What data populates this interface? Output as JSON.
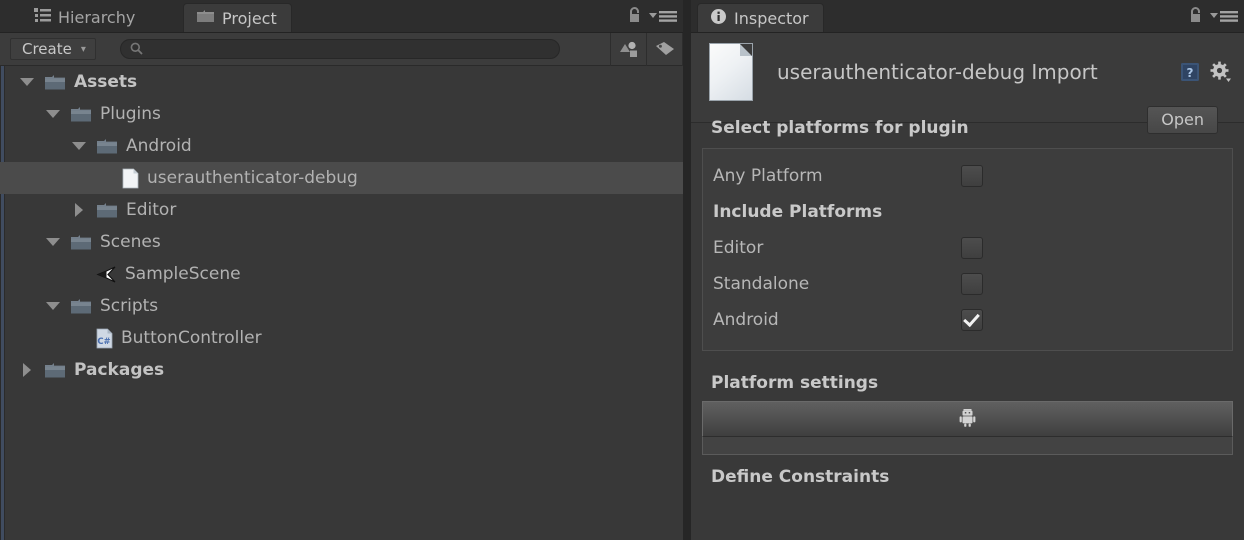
{
  "project_panel": {
    "tabs": [
      {
        "label": "Hierarchy",
        "icon": "hierarchy-list-icon",
        "active": false
      },
      {
        "label": "Project",
        "icon": "folder-icon",
        "active": true
      }
    ],
    "tabbar_controls": [
      {
        "name": "lock-icon"
      },
      {
        "name": "panel-menu-icon"
      }
    ],
    "toolbar": {
      "create_label": "Create",
      "create_caret": "▾",
      "search_value": "",
      "search_placeholder": "",
      "search_icon": "search-icon",
      "filter_type_icon": "filter-by-type-icon",
      "filter_label_icon": "filter-by-label-icon"
    },
    "tree": [
      {
        "label": "Assets",
        "depth": 0,
        "toggle": "down",
        "icon": "folder-icon",
        "bold": true,
        "selected": false
      },
      {
        "label": "Plugins",
        "depth": 1,
        "toggle": "down",
        "icon": "folder-icon",
        "bold": false,
        "selected": false
      },
      {
        "label": "Android",
        "depth": 2,
        "toggle": "down",
        "icon": "folder-icon",
        "bold": false,
        "selected": false
      },
      {
        "label": "userauthenticator-debug",
        "depth": 3,
        "toggle": "none",
        "icon": "file-icon",
        "bold": false,
        "selected": true
      },
      {
        "label": "Editor",
        "depth": 2,
        "toggle": "right",
        "icon": "folder-icon",
        "bold": false,
        "selected": false
      },
      {
        "label": "Scenes",
        "depth": 1,
        "toggle": "down",
        "icon": "folder-icon",
        "bold": false,
        "selected": false
      },
      {
        "label": "SampleScene",
        "depth": 2,
        "toggle": "none",
        "icon": "unity-scene-icon",
        "bold": false,
        "selected": false
      },
      {
        "label": "Scripts",
        "depth": 1,
        "toggle": "down",
        "icon": "folder-icon",
        "bold": false,
        "selected": false
      },
      {
        "label": "ButtonController",
        "depth": 2,
        "toggle": "none",
        "icon": "csharp-script-icon",
        "bold": false,
        "selected": false
      },
      {
        "label": "Packages",
        "depth": 0,
        "toggle": "right",
        "icon": "folder-icon",
        "bold": true,
        "selected": false
      }
    ]
  },
  "inspector": {
    "tab": {
      "label": "Inspector",
      "icon": "info-icon"
    },
    "tabbar_controls": [
      {
        "name": "lock-icon"
      },
      {
        "name": "panel-menu-icon"
      }
    ],
    "asset_title": "userauthenticator-debug Import",
    "asset_icon": "file-icon",
    "help_icon": "help-book-icon",
    "gear_icon": "gear-icon",
    "open_label": "Open",
    "select_platforms_title": "Select platforms for plugin",
    "platform_rows": [
      {
        "label": "Any Platform",
        "type": "checkbox",
        "checked": false
      },
      {
        "label": "Include Platforms",
        "type": "group",
        "checked": false
      },
      {
        "label": "Editor",
        "type": "checkbox",
        "checked": false
      },
      {
        "label": "Standalone",
        "type": "checkbox",
        "checked": false
      },
      {
        "label": "Android",
        "type": "checkbox",
        "checked": true
      }
    ],
    "platform_settings_title": "Platform settings",
    "platform_settings_tab_icon": "android-robot-icon",
    "define_constraints_title": "Define Constraints"
  },
  "colors": {
    "window_bg": "#383838",
    "tabbar_bg": "#2d2d2d",
    "active_tab_bg": "#3b3b3b",
    "toolbar_bg": "#3c3c3c",
    "row_selected_bg": "#4b4b4b",
    "text": "#b9b9b9",
    "heading_text": "#c9c9c9",
    "divider": "#262626",
    "focus_stripe": "#404c60"
  }
}
